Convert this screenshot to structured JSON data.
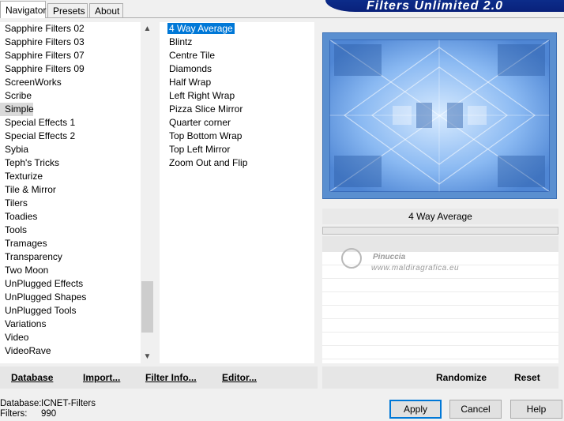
{
  "tabs": [
    "Navigator",
    "Presets",
    "About"
  ],
  "banner": "Filters Unlimited 2.0",
  "categories": [
    "Sapphire Filters 02",
    "Sapphire Filters 03",
    "Sapphire Filters 07",
    "Sapphire Filters 09",
    "ScreenWorks",
    "Scribe",
    "Simple",
    "Special Effects 1",
    "Special Effects 2",
    "Sybia",
    "Teph's Tricks",
    "Texturize",
    "Tile & Mirror",
    "Tilers",
    "Toadies",
    "Tools",
    "Tramages",
    "Transparency",
    "Two Moon",
    "UnPlugged Effects",
    "UnPlugged Shapes",
    "UnPlugged Tools",
    "Variations",
    "Video",
    "VideoRave"
  ],
  "filters": [
    "4 Way Average",
    "Blintz",
    "Centre Tile",
    "Diamonds",
    "Half Wrap",
    "Left Right Wrap",
    "Pizza Slice Mirror",
    "Quarter corner",
    "Top Bottom Wrap",
    "Top Left Mirror",
    "Zoom Out and Flip"
  ],
  "selected_filter_title": "4 Way Average",
  "watermark": {
    "line1": "Pinuccia",
    "line2": "www.maldiragrafica.eu"
  },
  "left_buttons": {
    "database": "Database",
    "import": "Import...",
    "filter_info": "Filter Info...",
    "editor": "Editor..."
  },
  "right_buttons": {
    "randomize": "Randomize",
    "reset": "Reset"
  },
  "status": {
    "database_label": "Database:",
    "database_value": "ICNET-Filters",
    "filters_label": "Filters:",
    "filters_value": "990"
  },
  "dialog_buttons": {
    "apply": "Apply",
    "cancel": "Cancel",
    "help": "Help"
  },
  "icons": {
    "scroll_up": "chevron-up-icon",
    "scroll_down": "chevron-down-icon"
  },
  "colors": {
    "selection": "#0078d7",
    "banner": "#0c2c8a",
    "preview_frame": "#5a8fd0"
  }
}
